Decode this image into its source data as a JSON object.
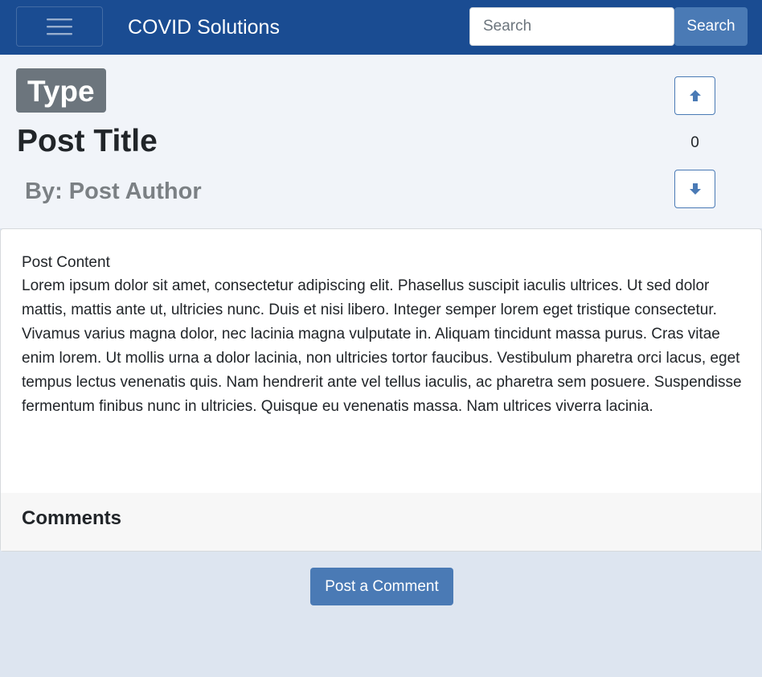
{
  "navbar": {
    "brand": "COVID Solutions",
    "menu_icon": "hamburger-icon",
    "search": {
      "placeholder": "Search",
      "value": "",
      "button_label": "Search"
    },
    "background_color": "#1a4c92"
  },
  "post": {
    "type": "Type",
    "title": "Post Title",
    "author": "By: Post Author",
    "votes": {
      "count": "0",
      "up_icon": "arrow-up-icon",
      "down_icon": "arrow-down-icon"
    },
    "content_heading": "Post Content",
    "content": "Lorem ipsum dolor sit amet, consectetur adipiscing elit. Phasellus suscipit iaculis ultrices. Ut sed dolor mattis, mattis ante ut, ultricies nunc. Duis et nisi libero. Integer semper lorem eget tristique consectetur. Vivamus varius magna dolor, nec lacinia magna vulputate in. Aliquam tincidunt massa purus. Cras vitae enim lorem. Ut mollis urna a dolor lacinia, non ultricies tortor faucibus. Vestibulum pharetra orci lacus, eget tempus lectus venenatis quis. Nam hendrerit ante vel tellus iaculis, ac pharetra sem posuere. Suspendisse fermentum finibus nunc in ultricies. Quisque eu venenatis massa. Nam ultrices viverra lacinia."
  },
  "comments": {
    "title": "Comments",
    "post_button_label": "Post a Comment"
  },
  "colors": {
    "accent": "#4a7ab5",
    "badge": "#6c757d",
    "page_background": "#dde5f0"
  }
}
